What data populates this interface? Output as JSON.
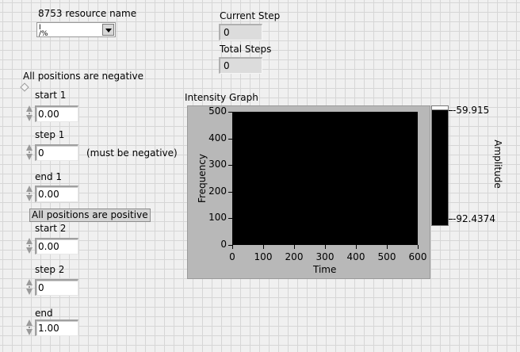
{
  "resource": {
    "label": "8753 resource name",
    "io_icon": "I/O",
    "value": ""
  },
  "current_step": {
    "label": "Current Step",
    "value": "0"
  },
  "total_steps": {
    "label": "Total Steps",
    "value": "0"
  },
  "negative": {
    "header": "All positions are negative",
    "start": {
      "label": "start 1",
      "value": "0.00"
    },
    "step": {
      "label": "step 1",
      "value": "0",
      "note": "(must be negative)"
    },
    "end": {
      "label": "end 1",
      "value": "0.00"
    }
  },
  "positive": {
    "header": "All positions are positive",
    "start": {
      "label": "start 2",
      "value": "0.00"
    },
    "step": {
      "label": "step 2",
      "value": "0"
    },
    "end": {
      "label": "end",
      "value": "1.00"
    }
  },
  "graph": {
    "title": "Intensity Graph",
    "xlabel": "Time",
    "ylabel": "Frequency",
    "xticks": [
      "0",
      "100",
      "200",
      "300",
      "400",
      "500",
      "600"
    ],
    "yticks": [
      "500",
      "400",
      "300",
      "200",
      "100",
      "0"
    ],
    "xlim": [
      0,
      600
    ],
    "ylim": [
      0,
      500
    ],
    "plot_color": "#000000",
    "colorscale": {
      "label": "Amplitude",
      "max": "-59.915",
      "min": "-92.4374"
    }
  }
}
